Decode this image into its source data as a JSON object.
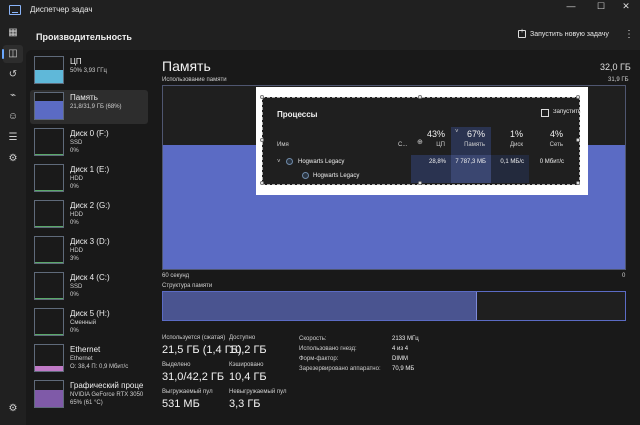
{
  "window": {
    "title": "Диспетчер задач",
    "controls": {
      "minimize": "—",
      "maximize": "☐",
      "close": "✕"
    }
  },
  "header": {
    "title": "Производительность",
    "run_task": "Запустить новую задачу",
    "more": "⋮"
  },
  "nav_rail": [
    {
      "icon": "processes-icon",
      "glyph": "▦"
    },
    {
      "icon": "performance-icon",
      "glyph": "◫",
      "active": true
    },
    {
      "icon": "app-history-icon",
      "glyph": "↺"
    },
    {
      "icon": "startup-icon",
      "glyph": "⌁"
    },
    {
      "icon": "users-icon",
      "glyph": "☺"
    },
    {
      "icon": "details-icon",
      "glyph": "☰"
    },
    {
      "icon": "services-icon",
      "glyph": "⚙"
    },
    {
      "icon": "settings-icon",
      "glyph": "⚙"
    }
  ],
  "perf_list": [
    {
      "name": "ЦП",
      "sub1": "50% 3,93 ГГц",
      "sub2": "",
      "level": 0.5,
      "color": "#5fb8d9"
    },
    {
      "name": "Память",
      "sub1": "21,8/31,9 ГБ (68%)",
      "sub2": "",
      "level": 0.68,
      "color": "#5b6bc4",
      "active": true
    },
    {
      "name": "Диск 0 (F:)",
      "sub1": "SSD",
      "sub2": "0%",
      "level": 0,
      "color": "#5aa86a"
    },
    {
      "name": "Диск 1 (E:)",
      "sub1": "HDD",
      "sub2": "0%",
      "level": 0,
      "color": "#5aa86a"
    },
    {
      "name": "Диск 2 (G:)",
      "sub1": "HDD",
      "sub2": "0%",
      "level": 0,
      "color": "#5aa86a"
    },
    {
      "name": "Диск 3 (D:)",
      "sub1": "HDD",
      "sub2": "3%",
      "level": 0.03,
      "color": "#5aa86a"
    },
    {
      "name": "Диск 4 (C:)",
      "sub1": "SSD",
      "sub2": "0%",
      "level": 0,
      "color": "#5aa86a"
    },
    {
      "name": "Диск 5 (H:)",
      "sub1": "Сменный",
      "sub2": "0%",
      "level": 0,
      "color": "#5aa86a"
    },
    {
      "name": "Ethernet",
      "sub1": "Ethernet",
      "sub2": "О: 38,4 П: 0,9 Мбит/с",
      "level": 0.2,
      "color": "#c07ac6"
    },
    {
      "name": "Графический проце",
      "sub1": "NVIDIA GeForce RTX 3050",
      "sub2": "65% (61 °C)",
      "level": 0.65,
      "color": "#7f5aa8"
    }
  ],
  "main": {
    "title": "Память",
    "total": "32,0 ГБ",
    "usage_label": "Использование памяти",
    "usage_max": "31,9 ГБ",
    "usage_level": 0.68,
    "axis_left": "60 секунд",
    "axis_right": "0",
    "structure_label": "Структура памяти",
    "structure_used": 0.68
  },
  "stats": {
    "in_use_label": "Используется (сжатая)",
    "in_use_value": "21,5 ГБ (1,4 ГБ)",
    "available_label": "Доступно",
    "available_value": "10,2 ГБ",
    "committed_label": "Выделено",
    "committed_value": "31,0/42,2 ГБ",
    "cached_label": "Кэшировано",
    "cached_value": "10,4 ГБ",
    "paged_label": "Выгружаемый пул",
    "paged_value": "531 МБ",
    "nonpaged_label": "Невыгружаемый пул",
    "nonpaged_value": "3,3 ГБ"
  },
  "right_stats": [
    {
      "label": "Скорость:",
      "value": "2133 МГц"
    },
    {
      "label": "Использовано гнезд:",
      "value": "4 из 4"
    },
    {
      "label": "Форм-фактор:",
      "value": "DIMM"
    },
    {
      "label": "Зарезервировано аппаратно:",
      "value": "70,9 МБ"
    }
  ],
  "popup": {
    "title": "Процессы",
    "run_label": "Запустить",
    "name_header": "Имя",
    "status_header": "С...",
    "columns": [
      {
        "pct": "43%",
        "name": "ЦП"
      },
      {
        "pct": "67%",
        "name": "Память"
      },
      {
        "pct": "1%",
        "name": "Диск"
      },
      {
        "pct": "4%",
        "name": "Сеть"
      }
    ],
    "rows": [
      {
        "name": "Hogwarts Legacy",
        "cpu": "28,8%",
        "mem": "7 787,3 МБ",
        "disk": "0,1 МБ/с",
        "net": "0 Мбит/с"
      },
      {
        "name": "Hogwarts Legacy"
      }
    ]
  }
}
